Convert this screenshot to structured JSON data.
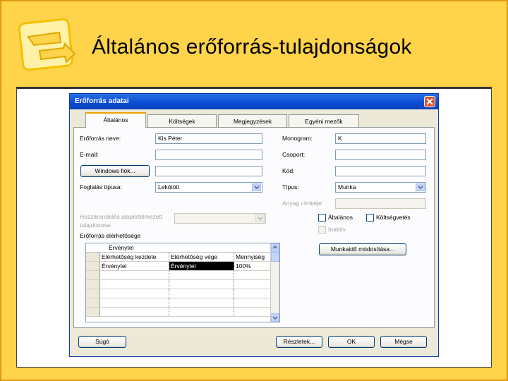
{
  "slide": {
    "title": "Általános erőforrás-tulajdonságok",
    "logo_icon": "yellow-arrow-logo-icon"
  },
  "dialog": {
    "title": "Erőforrás adatai",
    "close_icon": "close-icon",
    "tabs": [
      {
        "label": "Általános",
        "active": true
      },
      {
        "label": "Költségek",
        "active": false
      },
      {
        "label": "Megjegyzések",
        "active": false
      },
      {
        "label": "Egyéni mezők",
        "active": false
      }
    ],
    "left": {
      "name_label": "Erőforrás neve:",
      "name_value": "Kis Péter",
      "email_label": "E-mail:",
      "email_value": "",
      "windows_button": "Windows fiók...",
      "windows_value": "",
      "booking_label": "Foglalás típusa:",
      "booking_value": "Lekötött",
      "default_assign_label_1": "Hozzárendelés alapértelmezett",
      "default_assign_label_2": "tulajdonosa:",
      "default_assign_value": "",
      "availability_label": "Erőforrás elérhetősége"
    },
    "right": {
      "monogram_label": "Monogram:",
      "monogram_value": "K",
      "group_label": "Csoport:",
      "group_value": "",
      "code_label": "Kód:",
      "code_value": "",
      "type_label": "Típus:",
      "type_value": "Munka",
      "material_label": "Anyag címkéje:",
      "material_value": "",
      "generic_label": "Általános",
      "budget_label": "Költségvetés",
      "inactive_label": "Inaktív",
      "worktime_button": "Munkaidő módosítása..."
    },
    "grid": {
      "entry_value": "Érvénytel",
      "columns": [
        "Elérhetőség kezdete",
        "Elérhetőség vége",
        "Mennyiség"
      ],
      "rows": [
        [
          "Érvénytel",
          "Érvénytel",
          "100%"
        ]
      ]
    },
    "buttons": {
      "help": "Súgó",
      "details": "Részletek...",
      "ok": "OK",
      "cancel": "Mégse"
    },
    "colors": {
      "titlebar": "#0a4bd1",
      "slide_background": "#ffd34a",
      "close_button": "#d8522e"
    }
  }
}
